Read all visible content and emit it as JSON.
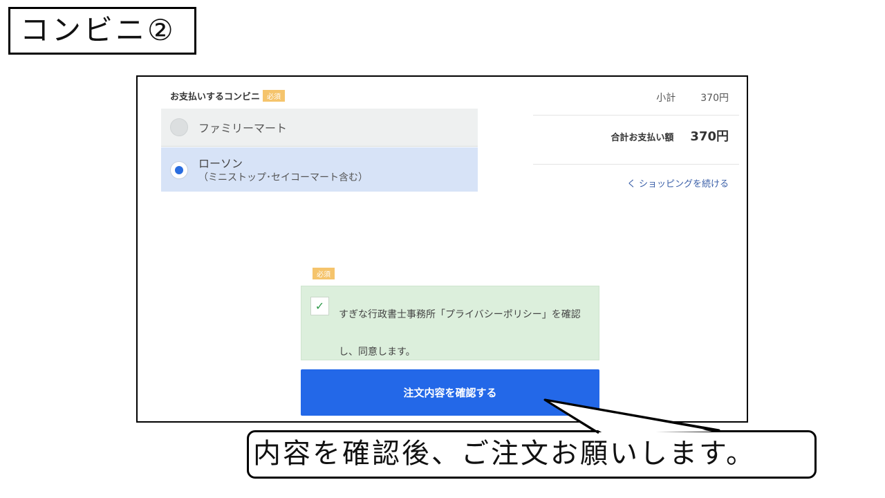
{
  "slide_title": "コンビニ②",
  "payment": {
    "section_label": "お支払いするコンビニ",
    "required_badge": "必須",
    "options": [
      {
        "name": "ファミリーマート",
        "sub": "",
        "selected": false
      },
      {
        "name": "ローソン",
        "sub": "（ミニストップ･セイコーマート含む）",
        "selected": true
      }
    ]
  },
  "summary": {
    "subtotal_label": "小計",
    "subtotal_value": "370円",
    "total_label": "合計お支払い額",
    "total_value": "370円",
    "continue_link": "く ショッピングを続ける"
  },
  "consent": {
    "required_badge": "必須",
    "checked": true,
    "check_mark": "✓",
    "text": "すぎな行政書士事務所「プライバシーポリシー」を確認し、同意します。"
  },
  "confirm_button_label": "注文内容を確認する",
  "callout_text": "内容を確認後、ご注文お願いします。",
  "colors": {
    "primary": "#2368e8",
    "badge": "#f5c46c",
    "consent_bg": "#dcefdc",
    "selected_bg": "#d7e3f7"
  }
}
